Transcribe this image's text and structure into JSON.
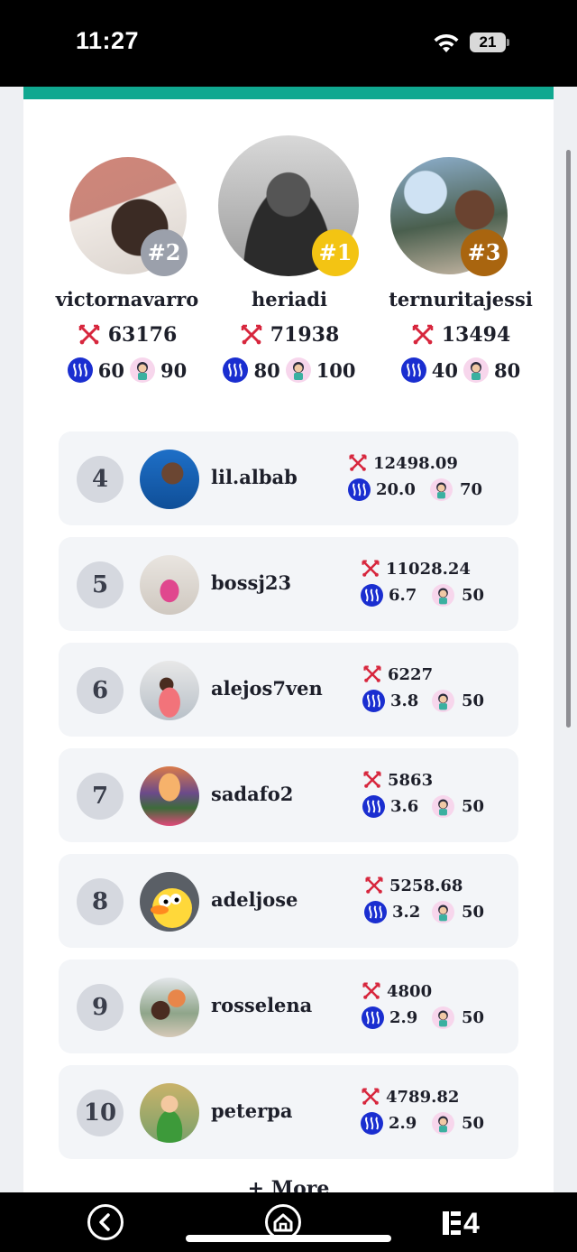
{
  "status_bar": {
    "time": "11:27",
    "battery": "21"
  },
  "podium": [
    {
      "rank_label": "#2",
      "username": "victornavarro",
      "score": "63176",
      "steem": "60",
      "kid": "90",
      "badge_color": "#9ba0ab"
    },
    {
      "rank_label": "#1",
      "username": "heriadi",
      "score": "71938",
      "steem": "80",
      "kid": "100",
      "badge_color": "#f3c413"
    },
    {
      "rank_label": "#3",
      "username": "ternuritajessi",
      "score": "13494",
      "steem": "40",
      "kid": "80",
      "badge_color": "#a9650f"
    }
  ],
  "rows": [
    {
      "rank": "4",
      "username": "lil.albab",
      "score": "12498.09",
      "steem": "20.0",
      "kid": "70"
    },
    {
      "rank": "5",
      "username": "bossj23",
      "score": "11028.24",
      "steem": "6.7",
      "kid": "50"
    },
    {
      "rank": "6",
      "username": "alejos7ven",
      "score": "6227",
      "steem": "3.8",
      "kid": "50"
    },
    {
      "rank": "7",
      "username": "sadafo2",
      "score": "5863",
      "steem": "3.6",
      "kid": "50"
    },
    {
      "rank": "8",
      "username": "adeljose",
      "score": "5258.68",
      "steem": "3.2",
      "kid": "50"
    },
    {
      "rank": "9",
      "username": "rosselena",
      "score": "4800",
      "steem": "2.9",
      "kid": "50"
    },
    {
      "rank": "10",
      "username": "peterpa",
      "score": "4789.82",
      "steem": "2.9",
      "kid": "50"
    }
  ],
  "more_label": "+ More",
  "bottom_nav": {
    "back_icon": "chevron-left-circle-icon",
    "home_icon": "home-icon",
    "tabs_label": "4"
  },
  "colors": {
    "accent": "#10a890",
    "steem_blue": "#1a2ed0",
    "sword_red": "#d7263d"
  }
}
